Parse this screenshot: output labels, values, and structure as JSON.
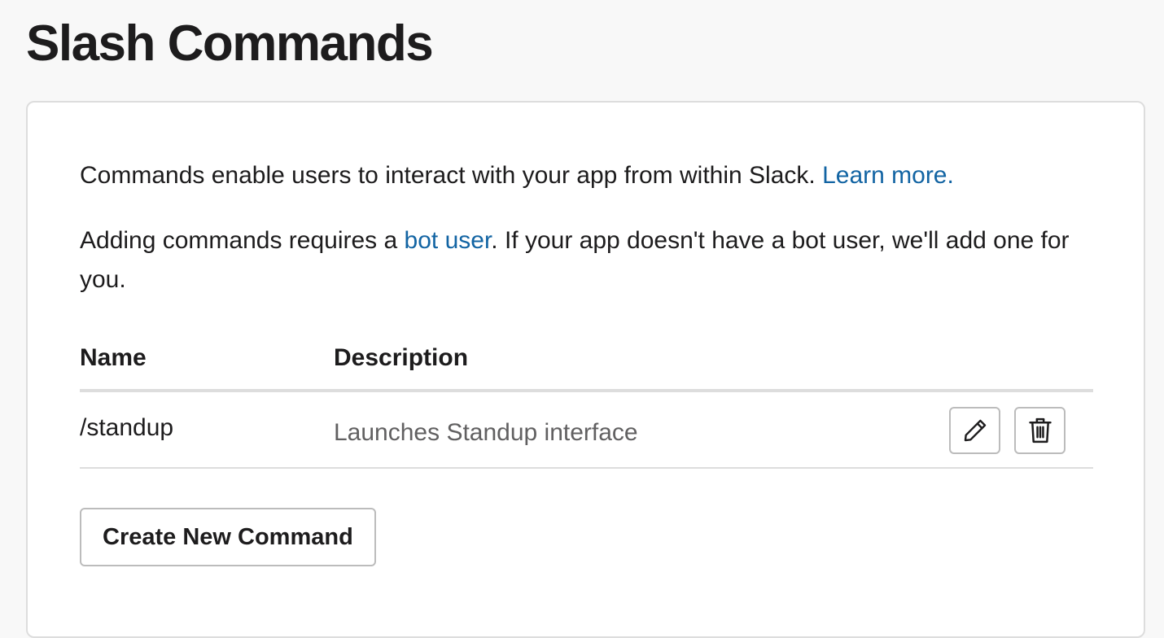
{
  "page": {
    "title": "Slash Commands"
  },
  "intro": {
    "line1_text": "Commands enable users to interact with your app from within Slack. ",
    "line1_link": "Learn more.",
    "line2_pre": "Adding commands requires a ",
    "line2_link": "bot user",
    "line2_post": ". If your app doesn't have a bot user, we'll add one for you."
  },
  "table": {
    "columns": [
      "Name",
      "Description"
    ],
    "rows": [
      {
        "name": "/standup",
        "description": "Launches Standup interface"
      }
    ]
  },
  "actions": {
    "create_label": "Create New Command"
  },
  "icons": {
    "edit": "pencil-icon",
    "delete": "trash-icon"
  },
  "colors": {
    "link": "#1264a3",
    "text": "#1d1c1d",
    "muted": "#616061",
    "border": "#dddddd",
    "background": "#f8f8f8"
  }
}
